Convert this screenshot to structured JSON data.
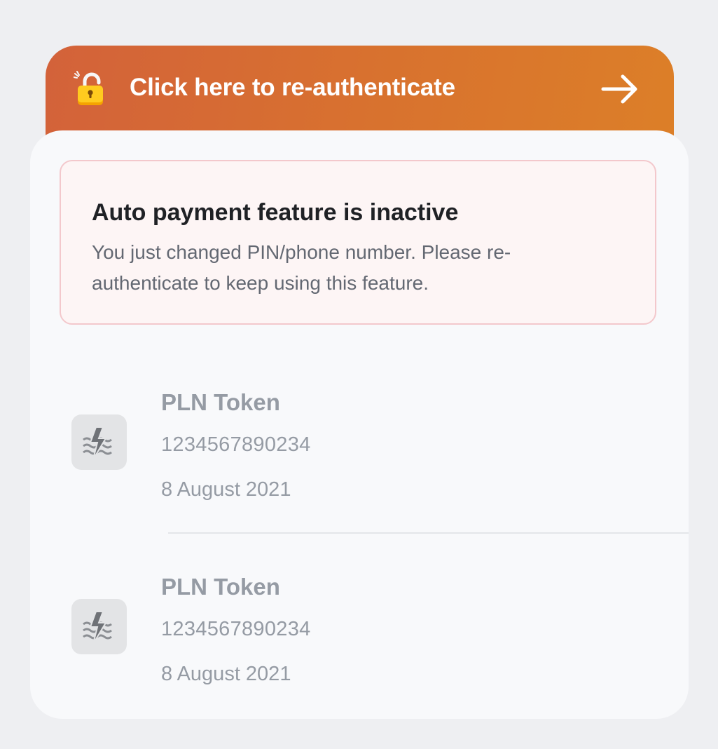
{
  "banner": {
    "label": "Click here to re-authenticate",
    "lock_icon": "unlocked-padlock-icon",
    "arrow_icon": "arrow-right-icon",
    "gradient": [
      "#d3623a",
      "#dc7f28"
    ]
  },
  "alert": {
    "title": "Auto payment feature is inactive",
    "message": "You just changed PIN/phone number. Please re-authenticate to keep using this feature."
  },
  "items": [
    {
      "name": "PLN Token",
      "number": "1234567890234",
      "date": "8 August 2021",
      "icon": "electricity-icon"
    },
    {
      "name": "PLN Token",
      "number": "1234567890234",
      "date": "8 August 2021",
      "icon": "electricity-icon"
    }
  ]
}
